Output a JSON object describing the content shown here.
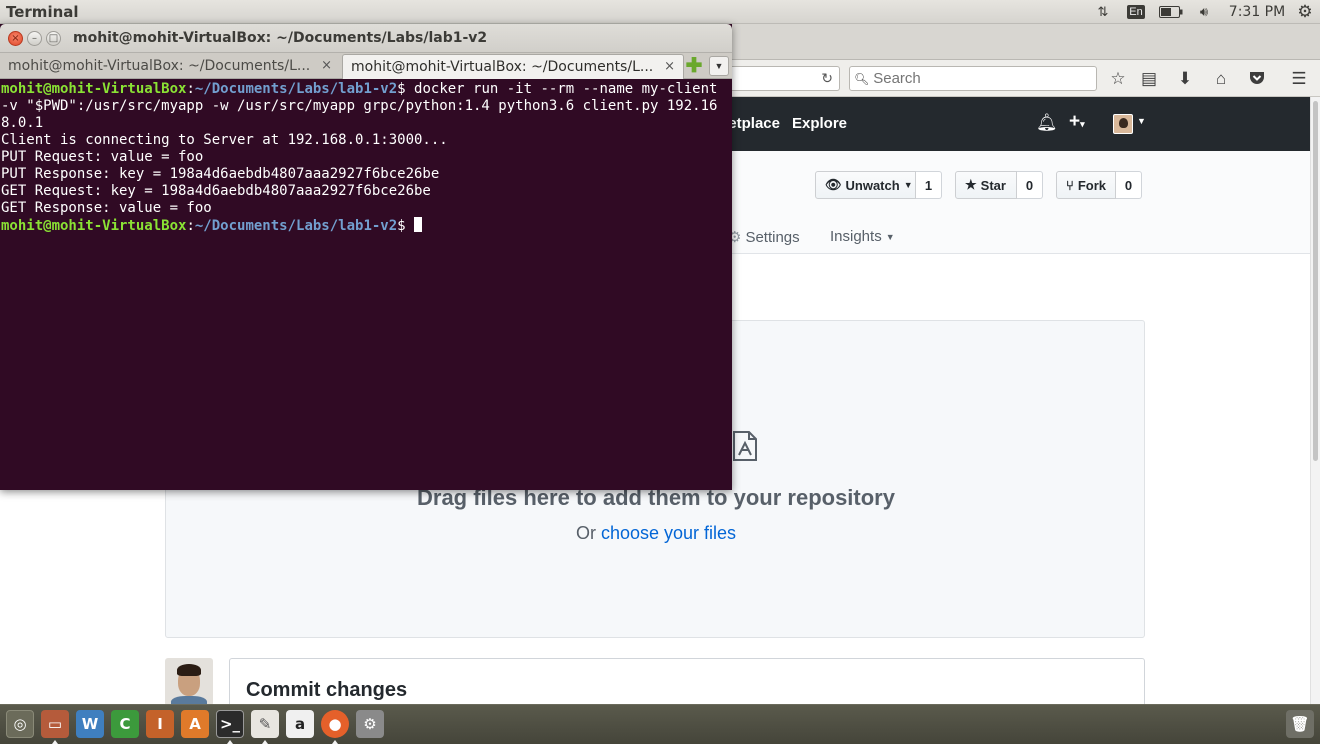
{
  "top_panel": {
    "app_name": "Terminal",
    "language": "En",
    "time": "7:31 PM"
  },
  "terminal": {
    "window_title": "mohit@mohit-VirtualBox: ~/Documents/Labs/lab1-v2",
    "tabs": [
      {
        "label": "mohit@mohit-VirtualBox: ~/Documents/L...",
        "close": "×"
      },
      {
        "label": "mohit@mohit-VirtualBox: ~/Documents/L...",
        "close": "×"
      }
    ],
    "new_tab": "✚",
    "tab_menu": "▼",
    "prompt_user": "mohit@mohit-VirtualBox",
    "prompt_sep": ":",
    "prompt_path": "~/Documents/Labs/lab1-v2",
    "prompt_end": "$ ",
    "command": "docker run -it --rm --name my-client -v \"$PWD\":/usr/src/myapp -w /usr/src/myapp grpc/python:1.4 python3.6 client.py 192.168.0.1",
    "output": [
      "Client is connecting to Server at 192.168.0.1:3000...",
      "PUT Request: value = foo",
      "PUT Response: key = 198a4d6aebdb4807aaa2927f6bce26be",
      "GET Request: key = 198a4d6aebdb4807aaa2927f6bce26be",
      "GET Response: value = foo"
    ]
  },
  "firefox": {
    "search_placeholder": "Search",
    "header": {
      "marketplace": "Marketplace",
      "explore": "Explore"
    },
    "repo_actions": {
      "watch_label": "Unwatch",
      "watch_count": "1",
      "star_label": "Star",
      "star_count": "0",
      "fork_label": "Fork",
      "fork_count": "0"
    },
    "repo_tabs": {
      "settings": "Settings",
      "insights": "Insights"
    },
    "upload": {
      "title": "Drag files here to add them to your repository",
      "or_text": "Or ",
      "choose_link": "choose your files"
    },
    "commit": {
      "title": "Commit changes"
    }
  },
  "launcher": {
    "icons": [
      "dash-icon",
      "files-icon",
      "writer-icon",
      "calc-icon",
      "impress-icon",
      "software-center-icon",
      "terminal-icon",
      "text-editor-icon",
      "amazon-icon",
      "firefox-icon",
      "system-settings-icon",
      "trash-icon"
    ]
  }
}
